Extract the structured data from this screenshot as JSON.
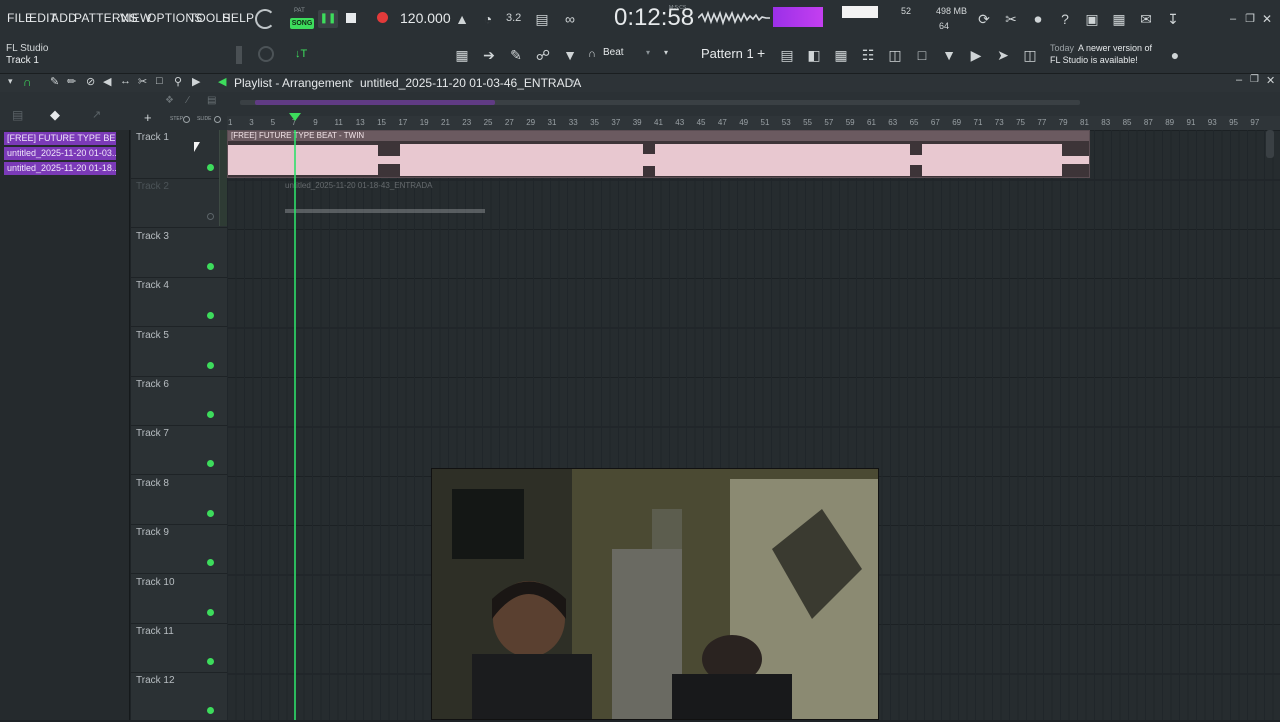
{
  "menu": {
    "items": [
      "FILE",
      "EDIT",
      "ADD",
      "PATTERNS",
      "VIEW",
      "OPTIONS",
      "TOOLS",
      "HELP"
    ],
    "pat_label": "PAT",
    "song_label": "SONG",
    "tempo": "120.000",
    "time": "0:12:58",
    "time_unit": "M:S:CS",
    "cpu_value": "52",
    "memory": "498 MB",
    "voices": "64",
    "step_value": "3.2"
  },
  "info": {
    "app_name": "FL Studio",
    "selected": "Track 1",
    "snap_label": "Beat",
    "pattern_label": "Pattern 1",
    "news_day": "Today",
    "news_text_1": "A newer version of",
    "news_text_2": "FL Studio is available!"
  },
  "playlist": {
    "title": "Playlist - Arrangement",
    "arrow": "▸",
    "project": "untitled_2025-11-20 01-03-46_ENTRADA",
    "step_label": "STEP",
    "slide_label": "SLIDE"
  },
  "picker": {
    "clips": [
      "[FREE] FUTURE TYPE BE...",
      "untitled_2025-11-20 01-03...",
      "untitled_2025-11-20 01-18..."
    ]
  },
  "tracks": [
    "Track 1",
    "Track 2",
    "Track 3",
    "Track 4",
    "Track 5",
    "Track 6",
    "Track 7",
    "Track 8",
    "Track 9",
    "Track 10",
    "Track 11",
    "Track 12"
  ],
  "clips": {
    "clip1": "[FREE] FUTURE TYPE BEAT - TWIN",
    "clip2": "untitled_2025-11-20 01-18-43_ENTRADA"
  },
  "ruler": [
    "1",
    "3",
    "5",
    "7",
    "9",
    "11",
    "13",
    "15",
    "17",
    "19",
    "21",
    "23",
    "25",
    "27",
    "29",
    "31",
    "33",
    "35",
    "37",
    "39",
    "41",
    "43",
    "45",
    "47",
    "49",
    "51",
    "53",
    "55",
    "57",
    "59",
    "61",
    "63",
    "65",
    "67",
    "69",
    "71",
    "73",
    "75",
    "77",
    "79",
    "81",
    "83",
    "85",
    "87",
    "89",
    "91",
    "93",
    "95",
    "97"
  ],
  "colors": {
    "accent_green": "#3ddc5c",
    "clip_purple": "#7b3ab8",
    "waveform_pink": "#e8c8d0",
    "record_red": "#e23a3a"
  }
}
